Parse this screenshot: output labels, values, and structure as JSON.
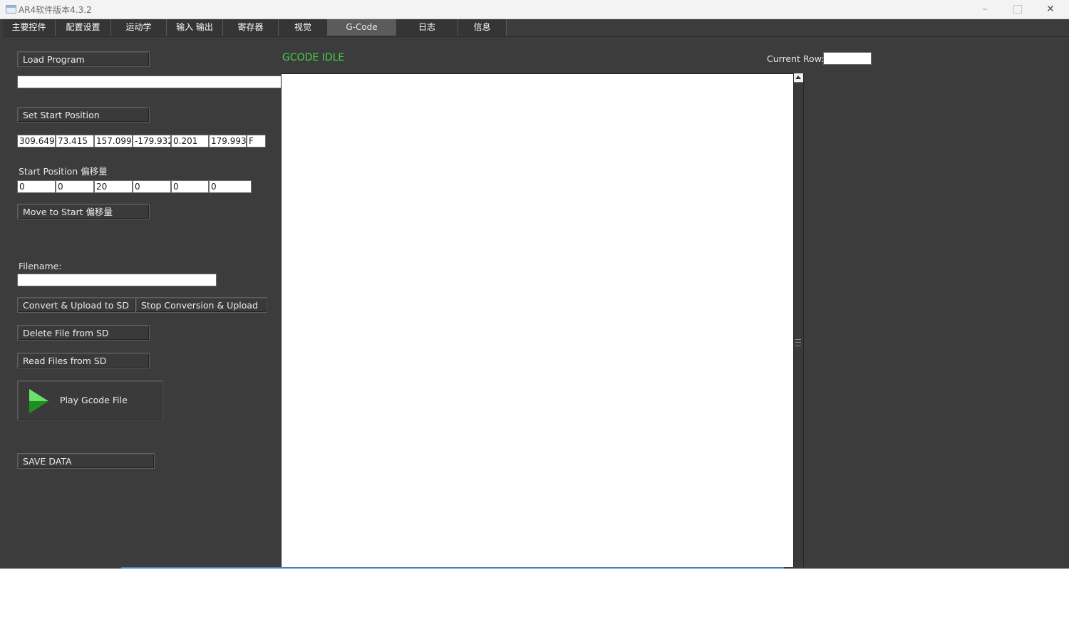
{
  "window": {
    "title": "AR4软件版本4.3.2",
    "min_glyph": "–",
    "close_glyph": "✕"
  },
  "tabs": [
    {
      "label": "主要控件"
    },
    {
      "label": "配置设置"
    },
    {
      "label": "运动学"
    },
    {
      "label": "输入 输出"
    },
    {
      "label": "寄存器"
    },
    {
      "label": "视觉"
    },
    {
      "label": "G-Code",
      "active": true
    },
    {
      "label": "日志"
    },
    {
      "label": "信息"
    }
  ],
  "gcode": {
    "load_program_label": "Load Program",
    "program_path": "",
    "set_start_position_label": "Set Start Position",
    "start_position_values": [
      "309.649",
      "73.415",
      "157.099",
      "-179.932",
      "0.201",
      "179.993",
      "F"
    ],
    "start_offset_label": "Start Position 偏移量",
    "start_offset_values": [
      "0",
      "0",
      "20",
      "0",
      "0",
      "0"
    ],
    "move_to_start_label": "Move to Start 偏移量",
    "filename_label": "Filename:",
    "filename_value": "",
    "convert_upload_label": "Convert & Upload to SD",
    "stop_conversion_label": "Stop Conversion & Upload",
    "delete_file_label": "Delete File from SD",
    "read_files_label": "Read Files from SD",
    "play_label": "Play Gcode File",
    "save_data_label": "SAVE DATA",
    "status_text": "GCODE IDLE",
    "status_color": "#47d14a",
    "current_row_label": "Current Row:",
    "current_row_value": "",
    "code_text": ""
  },
  "icons": {
    "play": "play-triangle-icon",
    "scroll_up": "chevron-up-icon"
  }
}
